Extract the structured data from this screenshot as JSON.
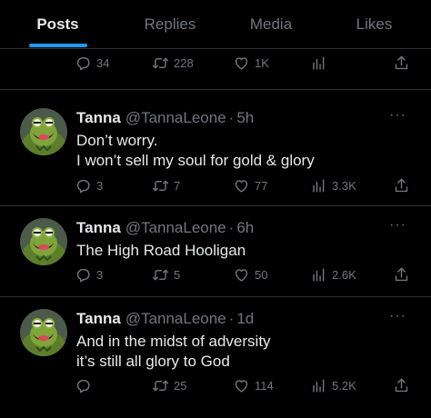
{
  "tabs": [
    {
      "label": "Posts",
      "active": true
    },
    {
      "label": "Replies",
      "active": false
    },
    {
      "label": "Media",
      "active": false
    },
    {
      "label": "Likes",
      "active": false
    }
  ],
  "top_actions": {
    "replies": "34",
    "reposts": "228",
    "likes": "1K",
    "views": ""
  },
  "tweets": [
    {
      "name": "Tanna",
      "handle": "@TannaLeone",
      "dot": "·",
      "time": "5h",
      "more": "···",
      "text": "Don’t worry.\nI won’t sell my soul for gold & glory",
      "replies": "3",
      "reposts": "7",
      "likes": "77",
      "views": "3.3K"
    },
    {
      "name": "Tanna",
      "handle": "@TannaLeone",
      "dot": "·",
      "time": "6h",
      "more": "···",
      "text": "The High Road Hooligan",
      "replies": "3",
      "reposts": "5",
      "likes": "50",
      "views": "2.6K"
    },
    {
      "name": "Tanna",
      "handle": "@TannaLeone",
      "dot": "·",
      "time": "1d",
      "more": "···",
      "text": "And in the midst of adversity\nit’s still all glory to God",
      "replies": "",
      "reposts": "25",
      "likes": "114",
      "views": "5.2K"
    }
  ],
  "icons": {
    "reply": "reply-icon",
    "repost": "repost-icon",
    "like": "heart-icon",
    "views": "views-icon",
    "share": "share-icon"
  },
  "colors": {
    "background": "#000000",
    "text": "#e7e9ea",
    "muted": "#71767b",
    "accent": "#1d9bf0",
    "border": "#2f3336"
  }
}
